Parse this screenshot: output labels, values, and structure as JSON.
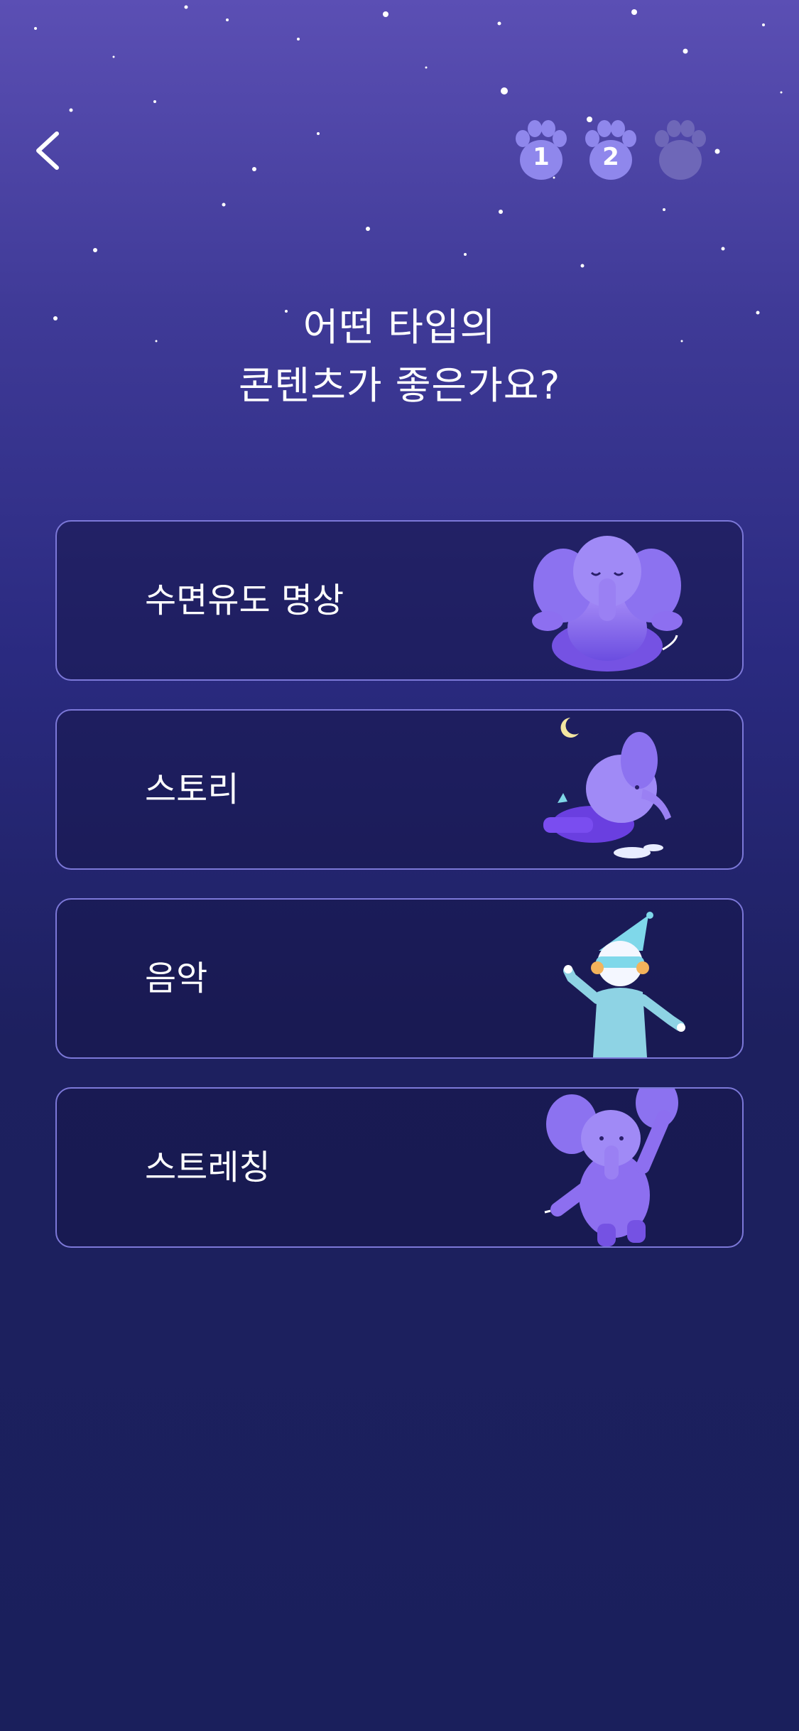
{
  "header": {
    "back_icon": "chevron-left-icon",
    "progress_steps": [
      {
        "label": "1",
        "state": "done"
      },
      {
        "label": "2",
        "state": "current"
      },
      {
        "label": "",
        "state": "pending"
      }
    ]
  },
  "question": {
    "line1": "어떤 타입의",
    "line2": "콘텐츠가 좋은가요?"
  },
  "options": [
    {
      "label": "수면유도 명상",
      "icon": "meditating-elephant-illustration"
    },
    {
      "label": "스토리",
      "icon": "flying-elephant-moon-illustration"
    },
    {
      "label": "음악",
      "icon": "sleeping-character-nightcap-illustration"
    },
    {
      "label": "스트레칭",
      "icon": "stretching-elephant-illustration"
    }
  ],
  "colors": {
    "background_top": "#5b4fb4",
    "background_bottom": "#1a1f5c",
    "card_border": "#7c78d8",
    "paw_active": "#8f87ec",
    "paw_pending": "#6e67b8",
    "elephant": "#8d6ff0"
  }
}
